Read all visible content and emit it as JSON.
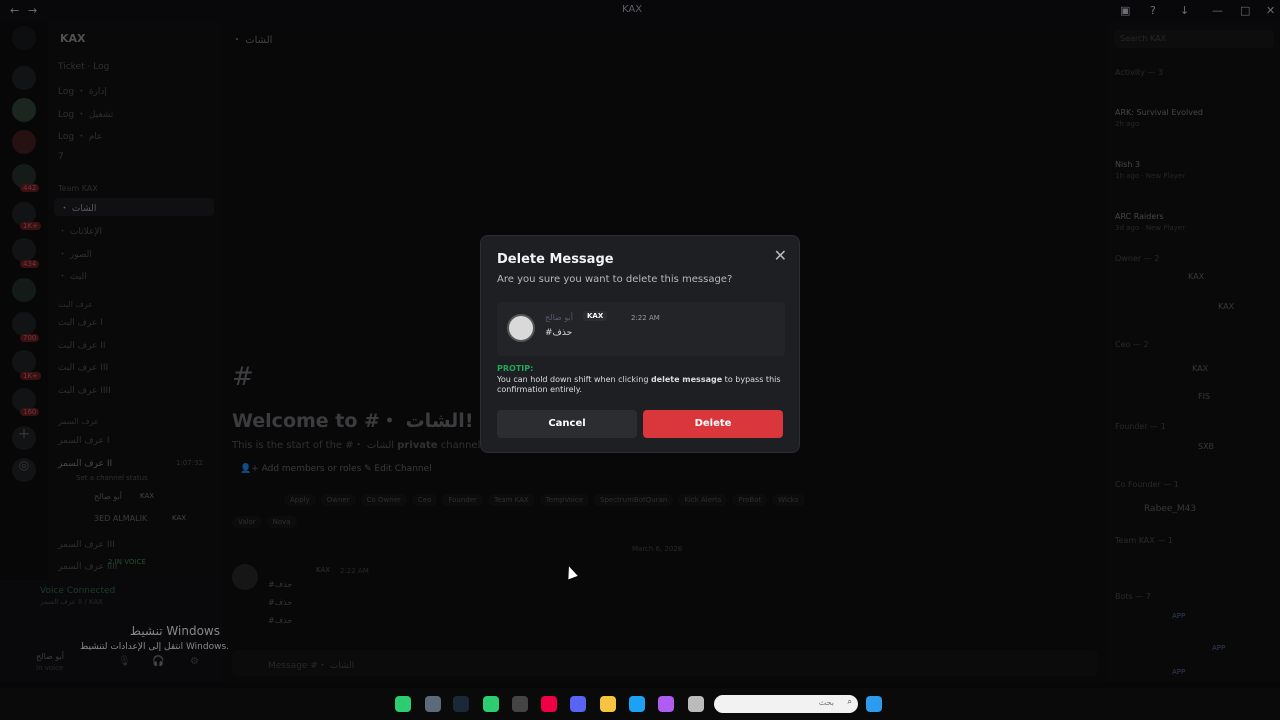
{
  "window": {
    "title": "KAX"
  },
  "server_badges": [
    "442",
    "1K+",
    "434",
    "700",
    "1K+",
    "160"
  ],
  "guild": {
    "name": "KAX"
  },
  "channels": {
    "items": [
      {
        "label": "Ticket · Log"
      },
      {
        "label": "Log ・ إدارة"
      },
      {
        "label": "Log ・ تشغيل"
      },
      {
        "label": "Log ・ عام"
      },
      {
        "label": "7"
      }
    ],
    "category_team": "Team KAX",
    "selected": "・ الشات",
    "team_items": [
      {
        "label": "・ الإعلانات"
      },
      {
        "label": "・ الصور"
      },
      {
        "label": "・ البث"
      }
    ],
    "category_voice": "عرف البث",
    "voice_items": [
      {
        "label": "عرف البث I"
      },
      {
        "label": "عرف البث II"
      },
      {
        "label": "عرف البث III"
      },
      {
        "label": "عرف البث IIII"
      }
    ],
    "category_voice2": "عرف السمر",
    "voice2_items": [
      {
        "label": "عرف السمر I"
      },
      {
        "label": "عرف السمر II"
      },
      {
        "label": "عرف السمر III"
      },
      {
        "label": "عرف السمر IIII"
      }
    ],
    "voice_timer": "1:07:32",
    "voice_status_placeholder": "Set a channel status",
    "voice_members": [
      {
        "name": "أبو صالح",
        "tag": "KAX"
      },
      {
        "name": "3ED ALMALIK",
        "tag": "KAX"
      }
    ],
    "in_voice_label": "2 IN VOICE"
  },
  "voice_panel": {
    "status": "Voice Connected",
    "location": "عرف السمر II / KAX",
    "user_name": "أبو صالح",
    "user_status": "In voice"
  },
  "main": {
    "header": "・ الشات",
    "welcome_title": "Welcome to #・ الشات!",
    "welcome_sub_prefix": "This is the start of the #",
    "welcome_sub_channel": "・ الشات",
    "welcome_sub_bold": "private",
    "welcome_sub_suffix": "channel.",
    "add_members": "Add members or roles",
    "edit_channel": "Edit Channel",
    "roles_row1": [
      "Apply",
      "Owner",
      "Co Owner",
      "Ceo",
      "Founder",
      "Team KAX",
      "TempVoice",
      "SpectrumBotQuran",
      "Kick Alerts",
      "ProBot",
      "Wicks"
    ],
    "roles_row2": [
      "Valor",
      "Nova"
    ],
    "date_divider": "March 6, 2026",
    "message": {
      "tag": "KAX",
      "time": "2:22 AM",
      "lines": [
        "#حذف",
        "#حذف",
        "#حذف"
      ]
    },
    "composer_placeholder": "Message #・ الشات"
  },
  "members": {
    "search_placeholder": "Search KAX",
    "activity_head": "Activity — 3",
    "activities": [
      {
        "title": "ARK: Survival Evolved",
        "meta": "2h ago"
      },
      {
        "title": "Nish 3",
        "meta": "1h ago · New Player"
      },
      {
        "title": "ARC Raiders",
        "meta": "3d ago · New Player"
      }
    ],
    "groups": [
      {
        "head": "Owner — 2",
        "members": [
          "KAX",
          "KAX"
        ]
      },
      {
        "head": "Ceo — 2",
        "members": [
          "KAX",
          "FIS"
        ]
      },
      {
        "head": "Founder — 1",
        "members": [
          "SXB"
        ]
      },
      {
        "head": "Co Founder — 1",
        "members": [
          "Rabee_M43"
        ]
      },
      {
        "head": "Team KAX — 1",
        "members": [
          ""
        ]
      },
      {
        "head": "Bots — 7",
        "members": [
          "APP",
          "APP",
          "APP"
        ]
      }
    ]
  },
  "modal": {
    "title": "Delete Message",
    "subtitle": "Are you sure you want to delete this message?",
    "preview_author": "أبو صالح",
    "preview_tag": "KAX",
    "preview_time": "2:22 AM",
    "preview_text": "#حذف",
    "protip_label": "PROTIP:",
    "protip_pre": "You can hold down shift when clicking ",
    "protip_bold": "delete message",
    "protip_post": " to bypass this confirmation entirely.",
    "cancel_label": "Cancel",
    "delete_label": "Delete"
  },
  "windows_activation": {
    "line1": "تنشيط Windows",
    "line2": "انتقل إلى الإعدادات لتنشيط Windows."
  },
  "taskbar": {
    "search_placeholder": "بحث"
  },
  "colors": {
    "accent_danger": "#da373c",
    "protip": "#23a55a",
    "modal_bg": "#1e1f22"
  }
}
